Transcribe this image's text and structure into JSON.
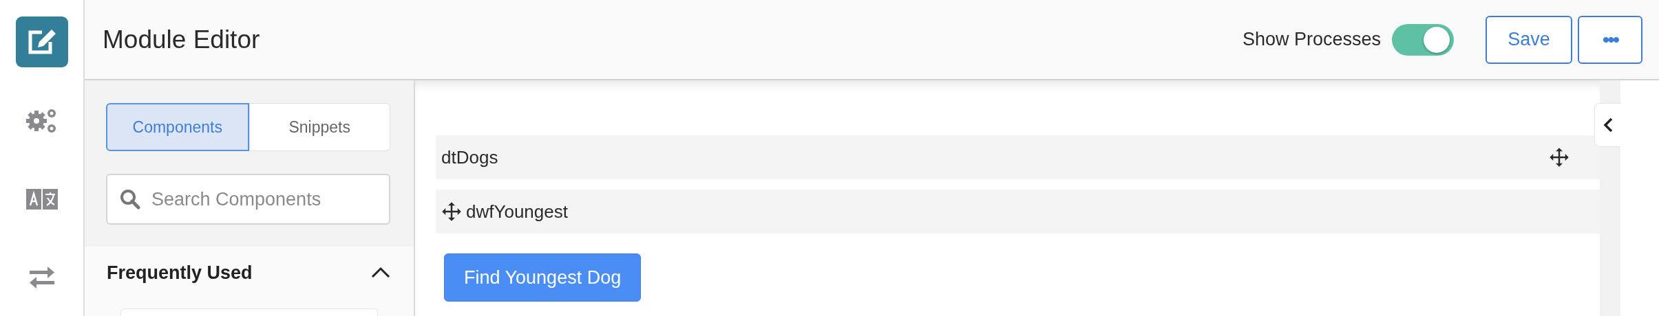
{
  "rail": {
    "items": [
      {
        "kind": "edit",
        "selected": true
      },
      {
        "kind": "gears",
        "selected": false
      },
      {
        "kind": "translate",
        "selected": false
      },
      {
        "kind": "swap",
        "selected": false
      }
    ]
  },
  "header": {
    "title": "Module Editor",
    "toggle": {
      "label": "Show Processes",
      "on": true
    },
    "save": "Save",
    "more": "•••"
  },
  "panel": {
    "tabs": [
      {
        "label": "Components",
        "selected": true
      },
      {
        "label": "Snippets",
        "selected": false
      }
    ],
    "search": {
      "placeholder": "Search Components"
    },
    "section": {
      "title": "Frequently Used",
      "expanded": true
    }
  },
  "canvas": {
    "rows": [
      {
        "name": "dtDogs",
        "kind": "trailing"
      },
      {
        "name": "dwfYoungest",
        "kind": "leading"
      }
    ],
    "button": "Find Youngest Dog"
  }
}
